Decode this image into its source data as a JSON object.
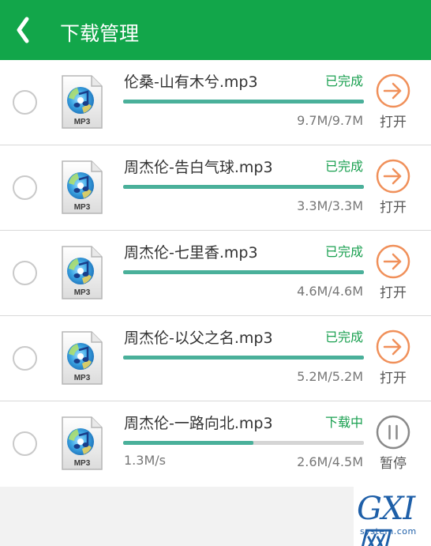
{
  "header": {
    "title": "下载管理",
    "back_icon": "chevron-left-icon",
    "bg_color": "#12a64a"
  },
  "file_icon": {
    "icon": "mp3-file-icon",
    "label": "MP3"
  },
  "downloads": [
    {
      "name": "伦桑-山有木兮.mp3",
      "status": "已完成",
      "size": "9.7M/9.7M",
      "speed": "",
      "progress": 1.0,
      "action_label": "打开",
      "action_icon": "open-arrow-icon"
    },
    {
      "name": "周杰伦-告白气球.mp3",
      "status": "已完成",
      "size": "3.3M/3.3M",
      "speed": "",
      "progress": 1.0,
      "action_label": "打开",
      "action_icon": "open-arrow-icon"
    },
    {
      "name": "周杰伦-七里香.mp3",
      "status": "已完成",
      "size": "4.6M/4.6M",
      "speed": "",
      "progress": 1.0,
      "action_label": "打开",
      "action_icon": "open-arrow-icon"
    },
    {
      "name": "周杰伦-以父之名.mp3",
      "status": "已完成",
      "size": "5.2M/5.2M",
      "speed": "",
      "progress": 1.0,
      "action_label": "打开",
      "action_icon": "open-arrow-icon"
    },
    {
      "name": "周杰伦-一路向北.mp3",
      "status": "下载中",
      "size": "2.6M/4.5M",
      "speed": "1.3M/s",
      "progress": 0.54,
      "action_label": "暂停",
      "action_icon": "pause-icon"
    }
  ],
  "colors": {
    "status_green": "#1aa050",
    "progress_fill": "#4ab09a",
    "open_orange": "#f0905a",
    "pause_gray": "#8a8a8a"
  },
  "watermark": {
    "text": "GXI网",
    "sub": "system.com"
  }
}
